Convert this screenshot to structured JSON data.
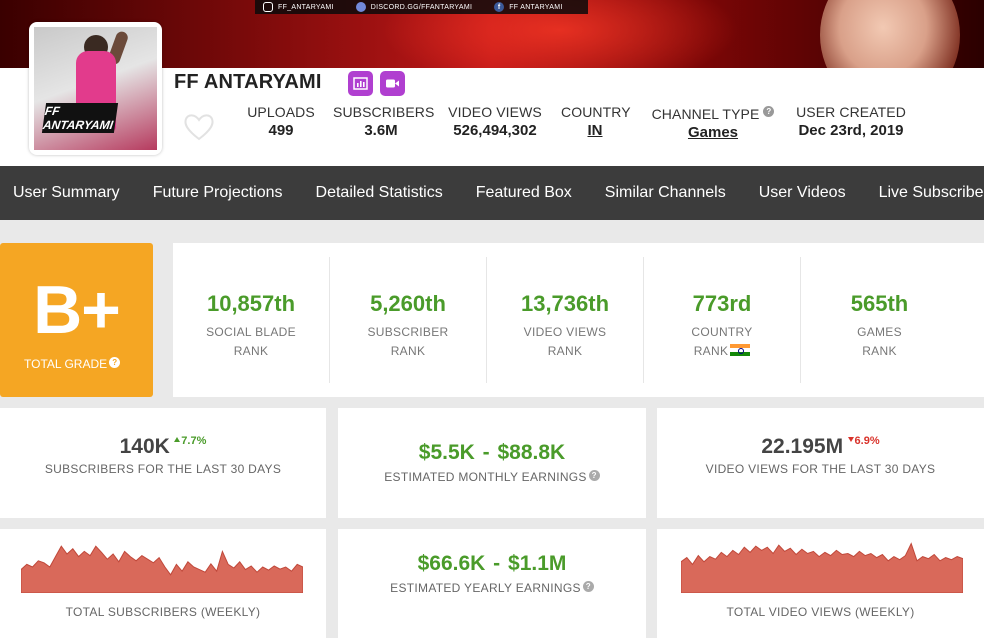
{
  "banner": {
    "social": [
      {
        "icon": "instagram-icon",
        "text": "FF_ANTARYAMI"
      },
      {
        "icon": "discord-icon",
        "text": "DISCORD.GG/FFANTARYAMI"
      },
      {
        "icon": "facebook-icon",
        "text": "FF ANTARYAMI"
      }
    ]
  },
  "channel": {
    "name": "FF ANTARYAMI",
    "avatar_logo": "FF ANTARYAMI",
    "badges": [
      "stats-icon",
      "video-camera-icon"
    ]
  },
  "stats": [
    {
      "label": "UPLOADS",
      "value": "499"
    },
    {
      "label": "SUBSCRIBERS",
      "value": "3.6M"
    },
    {
      "label": "VIDEO VIEWS",
      "value": "526,494,302"
    },
    {
      "label": "COUNTRY",
      "value": "IN"
    },
    {
      "label": "CHANNEL TYPE",
      "value": "Games"
    },
    {
      "label": "USER CREATED",
      "value": "Dec 23rd, 2019"
    }
  ],
  "nav": [
    "User Summary",
    "Future Projections",
    "Detailed Statistics",
    "Featured Box",
    "Similar Channels",
    "User Videos",
    "Live Subscriber"
  ],
  "grade": {
    "letter": "B+",
    "label": "TOTAL GRADE"
  },
  "ranks": [
    {
      "value": "10,857th",
      "line1": "SOCIAL BLADE",
      "line2": "RANK"
    },
    {
      "value": "5,260th",
      "line1": "SUBSCRIBER",
      "line2": "RANK"
    },
    {
      "value": "13,736th",
      "line1": "VIDEO VIEWS",
      "line2": "RANK"
    },
    {
      "value": "773rd",
      "line1": "COUNTRY",
      "line2": "RANK"
    },
    {
      "value": "565th",
      "line1": "GAMES",
      "line2": "RANK"
    }
  ],
  "cards": {
    "subs30": {
      "value": "140K",
      "delta": "7.7%",
      "caption": "SUBSCRIBERS FOR THE LAST 30 DAYS"
    },
    "monthly": {
      "low": "$5.5K",
      "sep": "-",
      "high": "$88.8K",
      "caption": "ESTIMATED MONTHLY EARNINGS"
    },
    "views30": {
      "value": "22.195M",
      "delta": "6.9%",
      "caption": "VIDEO VIEWS FOR THE LAST 30 DAYS"
    },
    "yearly": {
      "low": "$66.6K",
      "sep": "-",
      "high": "$1.1M",
      "caption": "ESTIMATED YEARLY EARNINGS"
    },
    "subs_weekly": {
      "caption": "TOTAL SUBSCRIBERS (WEEKLY)"
    },
    "views_weekly": {
      "caption": "TOTAL VIDEO VIEWS (WEEKLY)"
    }
  },
  "colors": {
    "accent_green": "#4a9b2a",
    "grade_orange": "#f5a623",
    "chart_fill": "#d9695a",
    "down_red": "#d9332b"
  },
  "sparklines": {
    "subscribers_weekly": [
      0.45,
      0.55,
      0.5,
      0.62,
      0.58,
      0.5,
      0.7,
      0.9,
      0.75,
      0.85,
      0.7,
      0.8,
      0.72,
      0.9,
      0.78,
      0.65,
      0.75,
      0.6,
      0.8,
      0.7,
      0.62,
      0.72,
      0.65,
      0.58,
      0.68,
      0.5,
      0.35,
      0.55,
      0.42,
      0.6,
      0.5,
      0.45,
      0.4,
      0.56,
      0.42,
      0.8,
      0.55,
      0.48,
      0.6,
      0.45,
      0.52,
      0.4,
      0.5,
      0.44,
      0.52,
      0.46,
      0.5,
      0.42,
      0.55,
      0.5
    ],
    "views_weekly": [
      0.6,
      0.68,
      0.55,
      0.72,
      0.6,
      0.7,
      0.65,
      0.78,
      0.7,
      0.82,
      0.74,
      0.88,
      0.78,
      0.9,
      0.82,
      0.88,
      0.76,
      0.92,
      0.8,
      0.86,
      0.74,
      0.84,
      0.76,
      0.8,
      0.7,
      0.78,
      0.72,
      0.82,
      0.74,
      0.76,
      0.7,
      0.8,
      0.72,
      0.76,
      0.68,
      0.74,
      0.62,
      0.7,
      0.64,
      0.72,
      0.95,
      0.62,
      0.7,
      0.66,
      0.74,
      0.62,
      0.68,
      0.64,
      0.7,
      0.66
    ]
  }
}
